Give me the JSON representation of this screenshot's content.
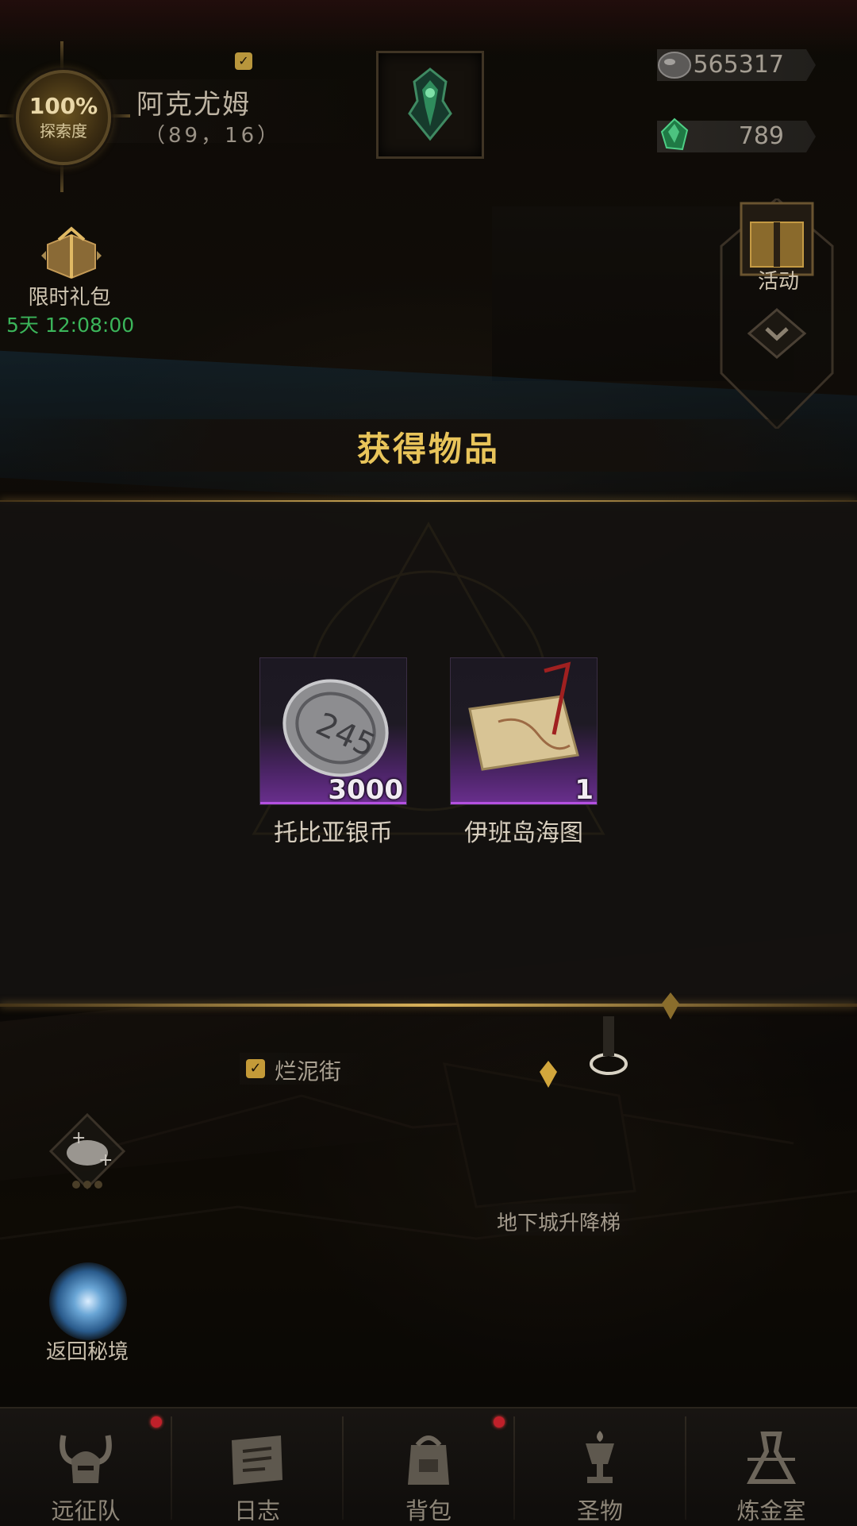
{
  "header": {
    "explore_percent": "100%",
    "explore_label": "探索度",
    "location_name": "阿克尤姆",
    "location_coords": "（89，16）",
    "currency": [
      {
        "name": "silver-coin",
        "value": "565317"
      },
      {
        "name": "green-gem",
        "value": "789"
      }
    ]
  },
  "left_panel": {
    "gift_label": "限时礼包",
    "gift_timer": "5天 12:08:00"
  },
  "right_panel": {
    "activity_label": "活动"
  },
  "modal": {
    "title": "获得物品",
    "items": [
      {
        "name": "托比亚银币",
        "count": "3000",
        "icon": "silver-coin-icon"
      },
      {
        "name": "伊班岛海图",
        "count": "1",
        "icon": "sea-chart-scroll-icon"
      }
    ]
  },
  "map": {
    "street_label": "烂泥街",
    "elevator_label": "地下城升降梯",
    "portal_label": "返回秘境"
  },
  "bottom_nav": [
    {
      "label": "远征队",
      "icon": "horned-helmet-icon",
      "badge": true
    },
    {
      "label": "日志",
      "icon": "journal-scroll-icon",
      "badge": false
    },
    {
      "label": "背包",
      "icon": "backpack-icon",
      "badge": true
    },
    {
      "label": "圣物",
      "icon": "relic-chalice-icon",
      "badge": false
    },
    {
      "label": "炼金室",
      "icon": "alchemy-icon",
      "badge": false
    }
  ],
  "colors": {
    "accent_gold": "#e8c45a",
    "timer_green": "#3bb55a",
    "rarity_purple": "#6a2f8e",
    "badge_red": "#c0202a"
  }
}
